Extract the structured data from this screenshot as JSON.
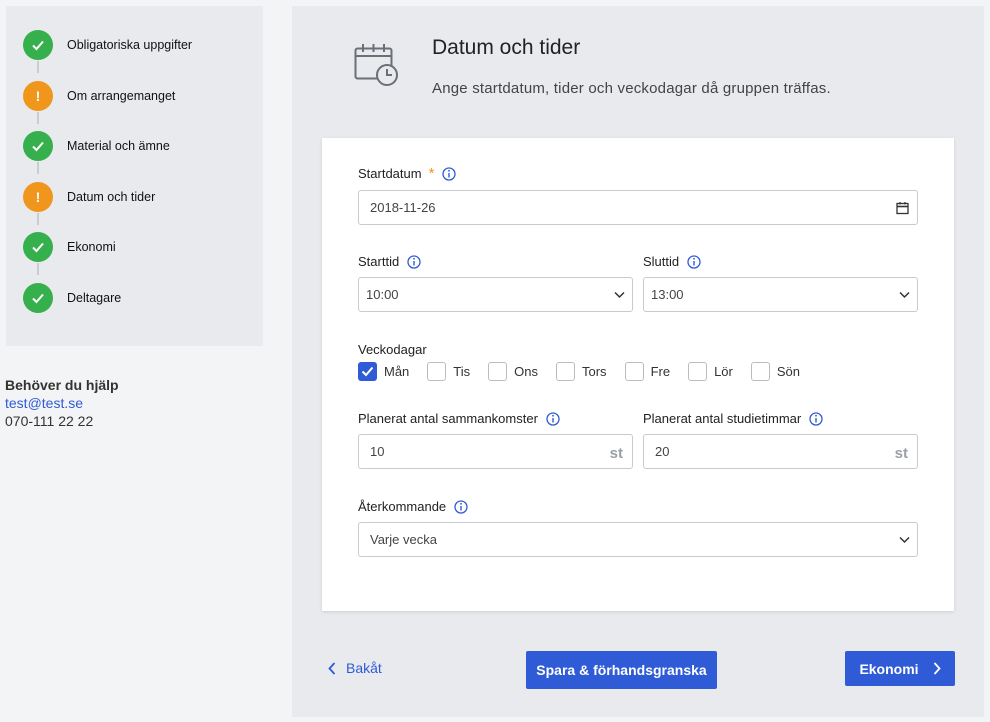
{
  "stepper": {
    "steps": [
      {
        "label": "Obligatoriska uppgifter",
        "status": "complete"
      },
      {
        "label": "Om arrangemanget",
        "status": "warning"
      },
      {
        "label": "Material och ämne",
        "status": "complete"
      },
      {
        "label": "Datum och tider",
        "status": "warning"
      },
      {
        "label": "Ekonomi",
        "status": "complete"
      },
      {
        "label": "Deltagare",
        "status": "complete"
      }
    ],
    "warning_symbol": "!"
  },
  "help": {
    "title": "Behöver du hjälp",
    "email": "test@test.se",
    "phone": "070-111 22 22"
  },
  "page": {
    "title": "Datum och tider",
    "subtitle": "Ange startdatum, tider och veckodagar då gruppen träffas."
  },
  "form": {
    "startdatum": {
      "label": "Startdatum",
      "required_mark": "*",
      "value": "2018-11-26"
    },
    "starttid": {
      "label": "Starttid",
      "value": "10:00"
    },
    "sluttid": {
      "label": "Sluttid",
      "value": "13:00"
    },
    "veckodagar": {
      "label": "Veckodagar",
      "days": [
        {
          "label": "Mån",
          "checked": true
        },
        {
          "label": "Tis",
          "checked": false
        },
        {
          "label": "Ons",
          "checked": false
        },
        {
          "label": "Tors",
          "checked": false
        },
        {
          "label": "Fre",
          "checked": false
        },
        {
          "label": "Lör",
          "checked": false
        },
        {
          "label": "Sön",
          "checked": false
        }
      ]
    },
    "sammankomster": {
      "label": "Planerat antal sammankomster",
      "value": "10",
      "unit": "st"
    },
    "studietimmar": {
      "label": "Planerat antal studietimmar",
      "value": "20",
      "unit": "st"
    },
    "aterkommande": {
      "label": "Återkommande",
      "value": "Varje vecka"
    }
  },
  "footer": {
    "back_label": "Bakåt",
    "save_label": "Spara & förhandsgranska",
    "next_label": "Ekonomi"
  },
  "colors": {
    "accent": "#2f5bd7",
    "success": "#35b04c",
    "warning": "#f0961c"
  }
}
